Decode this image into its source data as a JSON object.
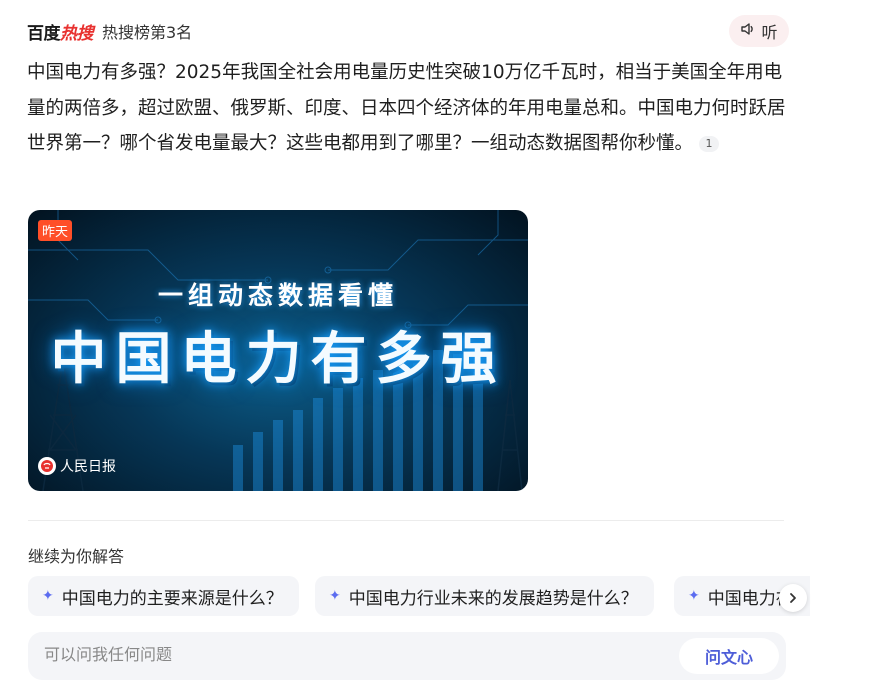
{
  "header": {
    "logo_main": "百度",
    "logo_accent": "热搜",
    "rank": "热搜榜第3名",
    "listen_label": "听"
  },
  "content": {
    "paragraph": "中国电力有多强？2025年我国全社会用电量历史性突破10万亿千瓦时，相当于美国全年用电量的两倍多，超过欧盟、俄罗斯、印度、日本四个经济体的年用电量总和。中国电力何时跃居世界第一？哪个省发电量最大？这些电都用到了哪里？一组动态数据图帮你秒懂。",
    "citation": "1"
  },
  "video_card": {
    "badge": "昨天",
    "kicker": "一组动态数据看懂",
    "headline": "中国电力有多强",
    "source": "人民日报",
    "colors": {
      "badge": "#ff4f28",
      "glow": "#1aa3ff"
    }
  },
  "follow_up": {
    "title": "继续为你解答",
    "questions": [
      "中国电力的主要来源是什么？",
      "中国电力行业未来的发展趋势是什么？",
      "中国电力在"
    ]
  },
  "ask": {
    "placeholder": "可以问我任何问题",
    "button": "问文心"
  },
  "icons": {
    "listen": "speaker-icon",
    "chip": "sparkle-icon",
    "next": "chevron-right-icon",
    "source": "people-daily-logo"
  }
}
